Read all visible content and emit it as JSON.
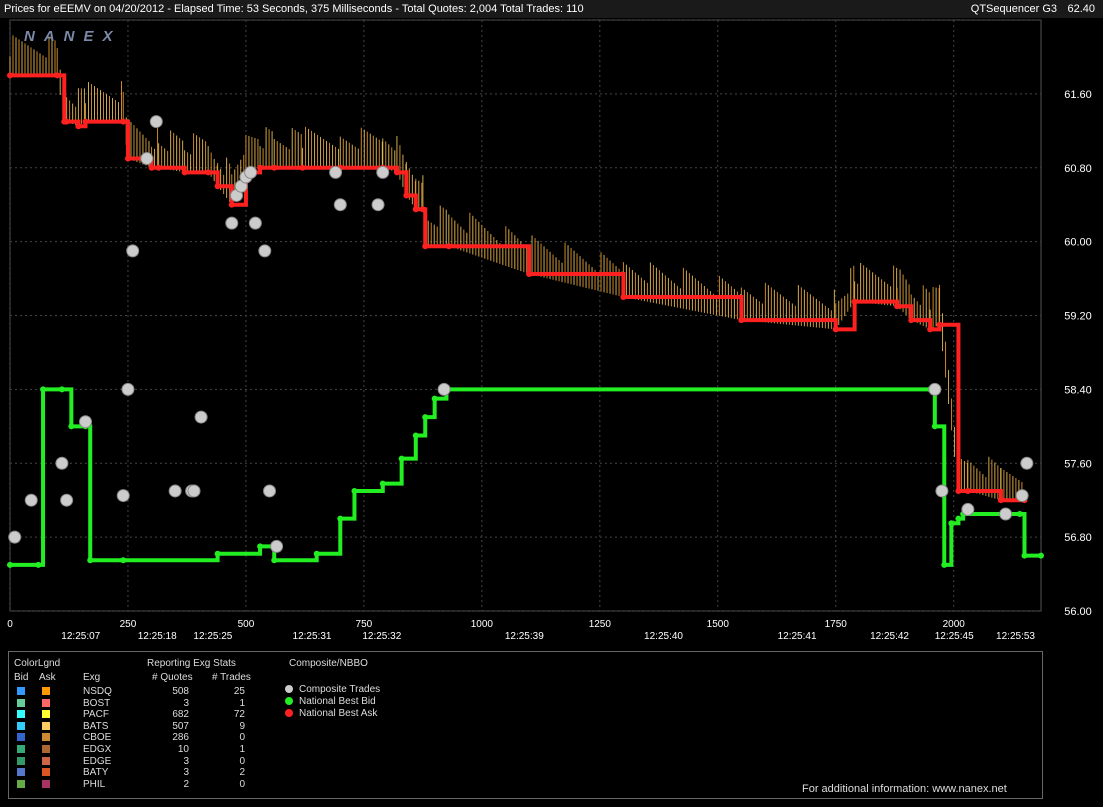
{
  "header": {
    "title_left": "Prices for  eEEMV  on  04/20/2012  -  Elapsed Time: 53 Seconds, 375 Milliseconds  -  Total Quotes: 2,004  Total Trades: 110",
    "title_right": "QTSequencer G3",
    "watermark": "NANEX"
  },
  "chart_data": {
    "type": "line",
    "y_ticks": [
      "62.40",
      "61.60",
      "60.80",
      "60.00",
      "59.20",
      "58.40",
      "57.60",
      "56.80",
      "56.00"
    ],
    "ylim": [
      56.0,
      62.4
    ],
    "x_ticks": [
      "0",
      "250",
      "500",
      "750",
      "1000",
      "1250",
      "1500",
      "1750",
      "2000"
    ],
    "xlim": [
      0,
      2185
    ],
    "time_labels": [
      {
        "x": 150,
        "label": "12:25:07"
      },
      {
        "x": 312,
        "label": "12:25:18"
      },
      {
        "x": 430,
        "label": "12:25:25"
      },
      {
        "x": 640,
        "label": "12:25:31"
      },
      {
        "x": 788,
        "label": "12:25:32"
      },
      {
        "x": 1090,
        "label": "12:25:39"
      },
      {
        "x": 1385,
        "label": "12:25:40"
      },
      {
        "x": 1668,
        "label": "12:25:41"
      },
      {
        "x": 1864,
        "label": "12:25:42"
      },
      {
        "x": 2001,
        "label": "12:25:45"
      },
      {
        "x": 2131,
        "label": "12:25:53"
      }
    ],
    "series": [
      {
        "name": "National Best Bid",
        "color": "#22ee22",
        "x": [
          0,
          60,
          70,
          110,
          130,
          160,
          170,
          240,
          440,
          530,
          560,
          650,
          700,
          730,
          790,
          830,
          860,
          880,
          900,
          925,
          1950,
          1960,
          1980,
          1995,
          2010,
          2020,
          2140,
          2150,
          2185
        ],
        "y": [
          56.5,
          56.5,
          58.4,
          58.4,
          58.0,
          58.0,
          56.55,
          56.55,
          56.62,
          56.7,
          56.55,
          56.62,
          57.0,
          57.3,
          57.38,
          57.65,
          57.9,
          58.1,
          58.3,
          58.4,
          58.4,
          58.0,
          56.5,
          56.95,
          57.0,
          57.05,
          57.05,
          56.6,
          56.6
        ]
      },
      {
        "name": "National Best Ask",
        "color": "#ff2020",
        "x": [
          0,
          100,
          115,
          120,
          145,
          160,
          240,
          250,
          300,
          315,
          370,
          420,
          440,
          470,
          500,
          530,
          560,
          620,
          700,
          790,
          820,
          840,
          860,
          875,
          880,
          930,
          1100,
          1300,
          1550,
          1750,
          1790,
          1880,
          1910,
          1950,
          1970,
          2010,
          2030,
          2100,
          2150
        ],
        "y": [
          61.8,
          61.8,
          61.3,
          61.3,
          61.25,
          61.3,
          61.3,
          60.9,
          60.8,
          60.8,
          60.75,
          60.75,
          60.6,
          60.4,
          60.75,
          60.8,
          60.8,
          60.8,
          60.8,
          60.8,
          60.75,
          60.5,
          60.35,
          60.35,
          59.95,
          59.95,
          59.65,
          59.4,
          59.15,
          59.05,
          59.35,
          59.3,
          59.15,
          59.05,
          59.1,
          57.3,
          57.3,
          57.2,
          57.2
        ]
      },
      {
        "name": "Composite Trades",
        "color": "#cccccc",
        "x": [
          10,
          45,
          110,
          120,
          160,
          240,
          250,
          260,
          290,
          310,
          350,
          385,
          390,
          405,
          470,
          480,
          490,
          500,
          510,
          520,
          540,
          550,
          565,
          690,
          700,
          780,
          790,
          920,
          1960,
          1975,
          2030,
          2110,
          2145,
          2155
        ],
        "y": [
          56.8,
          57.2,
          57.6,
          57.2,
          58.05,
          57.25,
          58.4,
          59.9,
          60.9,
          61.3,
          57.3,
          57.3,
          57.3,
          58.1,
          60.2,
          60.5,
          60.6,
          60.7,
          60.75,
          60.2,
          59.9,
          57.3,
          56.7,
          60.75,
          60.4,
          60.4,
          60.75,
          58.4,
          58.4,
          57.3,
          57.1,
          57.05,
          57.25,
          57.6
        ]
      }
    ],
    "legend": {
      "header_color": "ColorLgnd",
      "header_bid": "Bid",
      "header_ask": "Ask",
      "header_exg": "Exg",
      "header_stats": "Reporting Exg Stats",
      "header_quotes": "# Quotes",
      "header_trades": "# Trades",
      "header_composite": "Composite/NBBO",
      "rows": [
        {
          "exg": "NSDQ",
          "quotes": "508",
          "trades": "25",
          "bid": "#3399ff",
          "ask": "#ff9900"
        },
        {
          "exg": "BOST",
          "quotes": "3",
          "trades": "1",
          "bid": "#66cc99",
          "ask": "#ff6666"
        },
        {
          "exg": "PACF",
          "quotes": "682",
          "trades": "72",
          "bid": "#33ffff",
          "ask": "#ffff33"
        },
        {
          "exg": "BATS",
          "quotes": "507",
          "trades": "9",
          "bid": "#33ccff",
          "ask": "#ffcc66"
        },
        {
          "exg": "CBOE",
          "quotes": "286",
          "trades": "0",
          "bid": "#3366cc",
          "ask": "#cc8833"
        },
        {
          "exg": "EDGX",
          "quotes": "10",
          "trades": "1",
          "bid": "#33aa77",
          "ask": "#aa6633"
        },
        {
          "exg": "EDGE",
          "quotes": "3",
          "trades": "0",
          "bid": "#339966",
          "ask": "#cc6644"
        },
        {
          "exg": "BATY",
          "quotes": "3",
          "trades": "2",
          "bid": "#5577cc",
          "ask": "#dd5522"
        },
        {
          "exg": "PHIL",
          "quotes": "2",
          "trades": "0",
          "bid": "#66aa44",
          "ask": "#aa3366"
        }
      ],
      "composite_items": [
        {
          "label": "Composite Trades",
          "color": "#cccccc"
        },
        {
          "label": "National Best Bid",
          "color": "#22ee22"
        },
        {
          "label": "National Best Ask",
          "color": "#ff2020"
        }
      ]
    }
  },
  "footer": {
    "note": "For additional information: www.nanex.net"
  }
}
